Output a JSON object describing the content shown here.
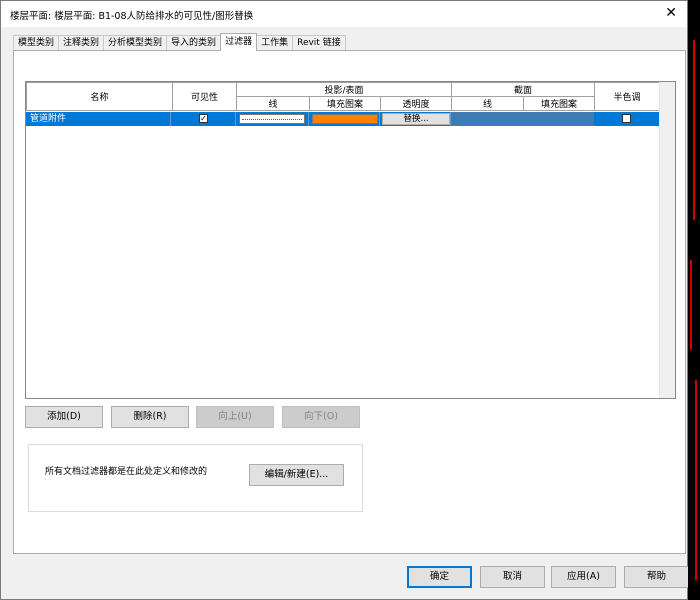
{
  "window": {
    "title": "楼层平面: 楼层平面: B1-08人防给排水的可见性/图形替换",
    "close_glyph": "✕"
  },
  "tabs": [
    {
      "label": "模型类别",
      "active": false
    },
    {
      "label": "注释类别",
      "active": false
    },
    {
      "label": "分析模型类别",
      "active": false
    },
    {
      "label": "导入的类别",
      "active": false
    },
    {
      "label": "过滤器",
      "active": true
    },
    {
      "label": "工作集",
      "active": false
    },
    {
      "label": "Revit 链接",
      "active": false
    }
  ],
  "grid": {
    "headers": {
      "name": "名称",
      "visibility": "可见性",
      "projection_surface": "投影/表面",
      "proj_line": "线",
      "proj_fill": "填充图案",
      "proj_transparency": "透明度",
      "cut": "截面",
      "cut_line": "线",
      "cut_fill": "填充图案",
      "halftone": "半色调"
    },
    "rows": [
      {
        "name": "管道附件",
        "visible": true,
        "fill_color": "#ff7f00",
        "transparency_button": "替换...",
        "halftone": false,
        "selected": true
      }
    ],
    "check_glyph": "✓"
  },
  "row_buttons": {
    "add": "添加(D)",
    "delete": "删除(R)",
    "up": "向上(U)",
    "down": "向下(O)"
  },
  "filter_panel": {
    "note": "所有文档过滤器都是在此处定义和修改的",
    "edit_button": "编辑/新建(E)..."
  },
  "footer": {
    "ok": "确定",
    "cancel": "取消",
    "apply": "应用(A)",
    "help": "帮助"
  },
  "colors": {
    "selection": "#0078d7",
    "fill_swatch": "#ff7f00",
    "cut_shade": "#3e7ab3"
  }
}
